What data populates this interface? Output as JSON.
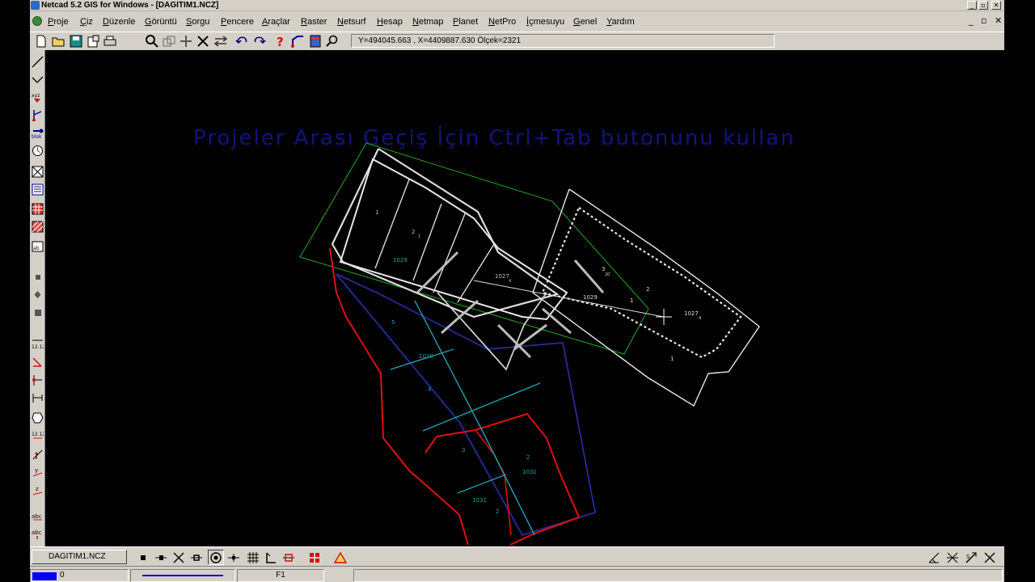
{
  "window": {
    "title": "Netcad 5.2 GIS for Windows - [DAGITIM1.NCZ]",
    "controls": [
      "_",
      "▫",
      "✕"
    ]
  },
  "menu": {
    "items": [
      "Proje",
      "Çiz",
      "Düzenle",
      "Görüntü",
      "Sorgu",
      "Pencere",
      "Araçlar",
      "Raster",
      "Netsurf",
      "Hesap",
      "Netmap",
      "Planet",
      "NetPro",
      "İçmesuyu",
      "Genel",
      "Yardım"
    ],
    "mdi_controls": [
      "_",
      "▫",
      "✕"
    ]
  },
  "toolbar": {
    "coords": "Y=494045.663 , X=4409887.630 Ölçek=2321"
  },
  "canvas": {
    "message": "Projeler Arası Geçiş İçin Ctrl+Tab butonunu kullan",
    "parcel_labels": [
      "1",
      "2",
      "1029",
      "1027",
      "3",
      "1029",
      "2",
      "1",
      "1027",
      "1",
      "5",
      "1030",
      "4",
      "3",
      "1031",
      "2",
      "1031",
      "2"
    ],
    "parcel_subscripts": [
      "1",
      "4",
      "20",
      "4"
    ],
    "colors": {
      "background": "#000000",
      "message": "#14147a",
      "boundary_green": "#22aa22",
      "parcel_white": "#e0e0e0",
      "road_red": "#e01010",
      "border_navy": "#2a2a9a",
      "split_cyan": "#20a0b0"
    }
  },
  "bottom": {
    "doc_tab": "DAGITIM1.NCZ"
  },
  "status": {
    "layer_value": "0",
    "function_key": "F1"
  }
}
